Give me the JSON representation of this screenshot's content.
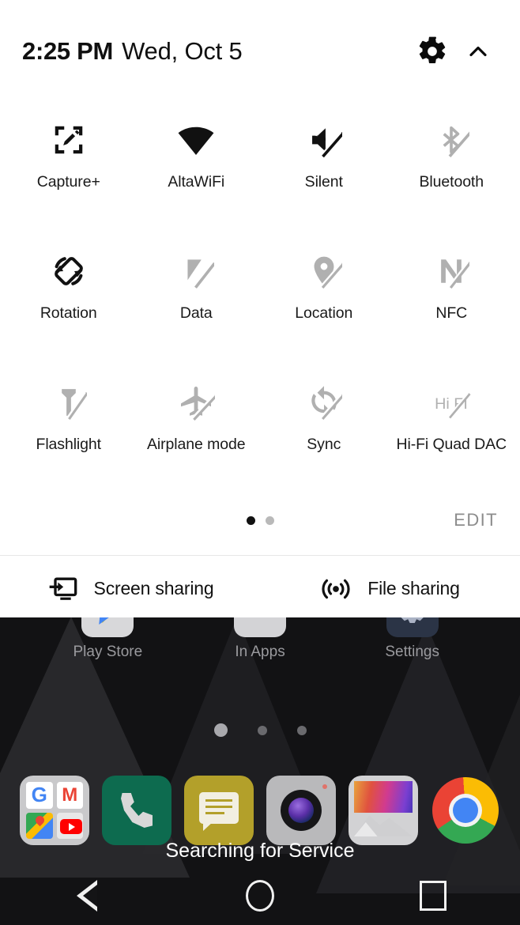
{
  "status": {
    "time": "2:25 PM",
    "date": "Wed, Oct 5",
    "gear_icon": "gear-icon",
    "collapse_icon": "chevron-up-icon"
  },
  "colors": {
    "panel_bg": "#ffffff",
    "tile_active": "#111111",
    "tile_disabled": "#b0b0b0",
    "label": "#1a1a1a",
    "edit": "#8c8c8c",
    "home_bg": "#121214"
  },
  "quick_settings": {
    "tiles": [
      {
        "label": "Capture+",
        "icon": "capture-plus-icon",
        "enabled": true
      },
      {
        "label": "AltaWiFi",
        "icon": "wifi-icon",
        "enabled": true
      },
      {
        "label": "Silent",
        "icon": "volume-mute-icon",
        "enabled": true
      },
      {
        "label": "Bluetooth",
        "icon": "bluetooth-off-icon",
        "enabled": false
      },
      {
        "label": "Rotation",
        "icon": "screen-rotation-icon",
        "enabled": true
      },
      {
        "label": "Data",
        "icon": "mobile-data-off-icon",
        "enabled": false
      },
      {
        "label": "Location",
        "icon": "location-off-icon",
        "enabled": false
      },
      {
        "label": "NFC",
        "icon": "nfc-off-icon",
        "enabled": false
      },
      {
        "label": "Flashlight",
        "icon": "flashlight-off-icon",
        "enabled": false
      },
      {
        "label": "Airplane mode",
        "icon": "airplane-off-icon",
        "enabled": false
      },
      {
        "label": "Sync",
        "icon": "sync-off-icon",
        "enabled": false
      },
      {
        "label": "Hi-Fi Quad DAC",
        "icon": "hifi-off-icon",
        "enabled": false
      }
    ],
    "page_dots": {
      "count": 2,
      "active_index": 0
    },
    "edit_label": "EDIT",
    "sharing": [
      {
        "label": "Screen sharing",
        "icon": "cast-screen-icon"
      },
      {
        "label": "File sharing",
        "icon": "broadcast-icon"
      }
    ]
  },
  "home_screen": {
    "apps": [
      {
        "label": "Play Store",
        "icon": "play-store-icon"
      },
      {
        "label": "In Apps",
        "icon": "in-apps-icon"
      },
      {
        "label": "Settings",
        "icon": "settings-icon"
      }
    ],
    "page_dots": {
      "count": 3,
      "active_index": 0
    },
    "dock": [
      {
        "name": "google-folder-icon"
      },
      {
        "name": "phone-icon"
      },
      {
        "name": "messages-icon"
      },
      {
        "name": "camera-icon"
      },
      {
        "name": "gallery-icon"
      },
      {
        "name": "chrome-icon"
      }
    ],
    "service_status": "Searching for Service"
  },
  "navigation_bar": {
    "back": "back-icon",
    "home": "home-icon",
    "recents": "recents-icon"
  }
}
